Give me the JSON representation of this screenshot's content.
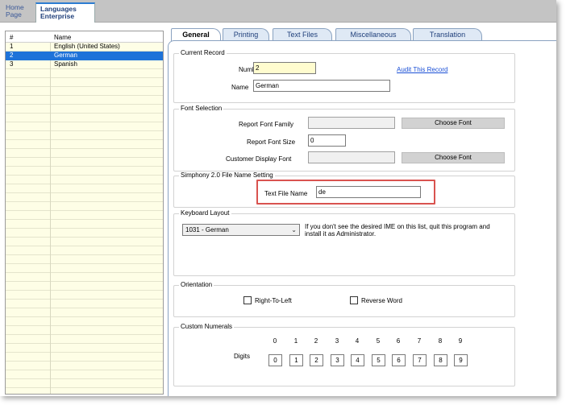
{
  "top_tabs": [
    {
      "line1": "Home",
      "line2": "Page"
    },
    {
      "line1": "Languages",
      "line2": "Enterprise"
    }
  ],
  "grid": {
    "headers": [
      "#",
      "Name"
    ],
    "rows": [
      {
        "num": "1",
        "name": "English (United States)"
      },
      {
        "num": "2",
        "name": "German"
      },
      {
        "num": "3",
        "name": "Spanish"
      }
    ]
  },
  "tabs": [
    "General",
    "Printing",
    "Text Files",
    "Miscellaneous",
    "Translation"
  ],
  "current_record": {
    "title": "Current Record",
    "number_label": "Number",
    "number_value": "2",
    "audit_link": "Audit This Record",
    "name_label": "Name",
    "name_value": "German"
  },
  "font_selection": {
    "title": "Font Selection",
    "report_font_family_label": "Report Font Family",
    "report_font_size_label": "Report Font Size",
    "report_font_size_value": "0",
    "customer_display_font_label": "Customer Display Font",
    "choose_font_label": "Choose Font"
  },
  "simphony": {
    "title": "Simphony 2.0 File Name Setting",
    "text_file_name_label": "Text File Name",
    "text_file_name_value": "de"
  },
  "keyboard": {
    "title": "Keyboard Layout",
    "selected": "1031 - German",
    "note": "If you don't see the desired IME on this list, quit this program and install it as Administrator."
  },
  "orientation": {
    "title": "Orientation",
    "rtl_label": "Right-To-Left",
    "reverse_label": "Reverse Word"
  },
  "numerals": {
    "title": "Custom Numerals",
    "digits_label": "Digits",
    "headers": [
      "0",
      "1",
      "2",
      "3",
      "4",
      "5",
      "6",
      "7",
      "8",
      "9"
    ],
    "values": [
      "0",
      "1",
      "2",
      "3",
      "4",
      "5",
      "6",
      "7",
      "8",
      "9"
    ]
  },
  "colors": {
    "selection": "#1e73d9",
    "grid_bg": "#fefee6",
    "highlight": "#d9534f",
    "link": "#1a4fd6"
  }
}
